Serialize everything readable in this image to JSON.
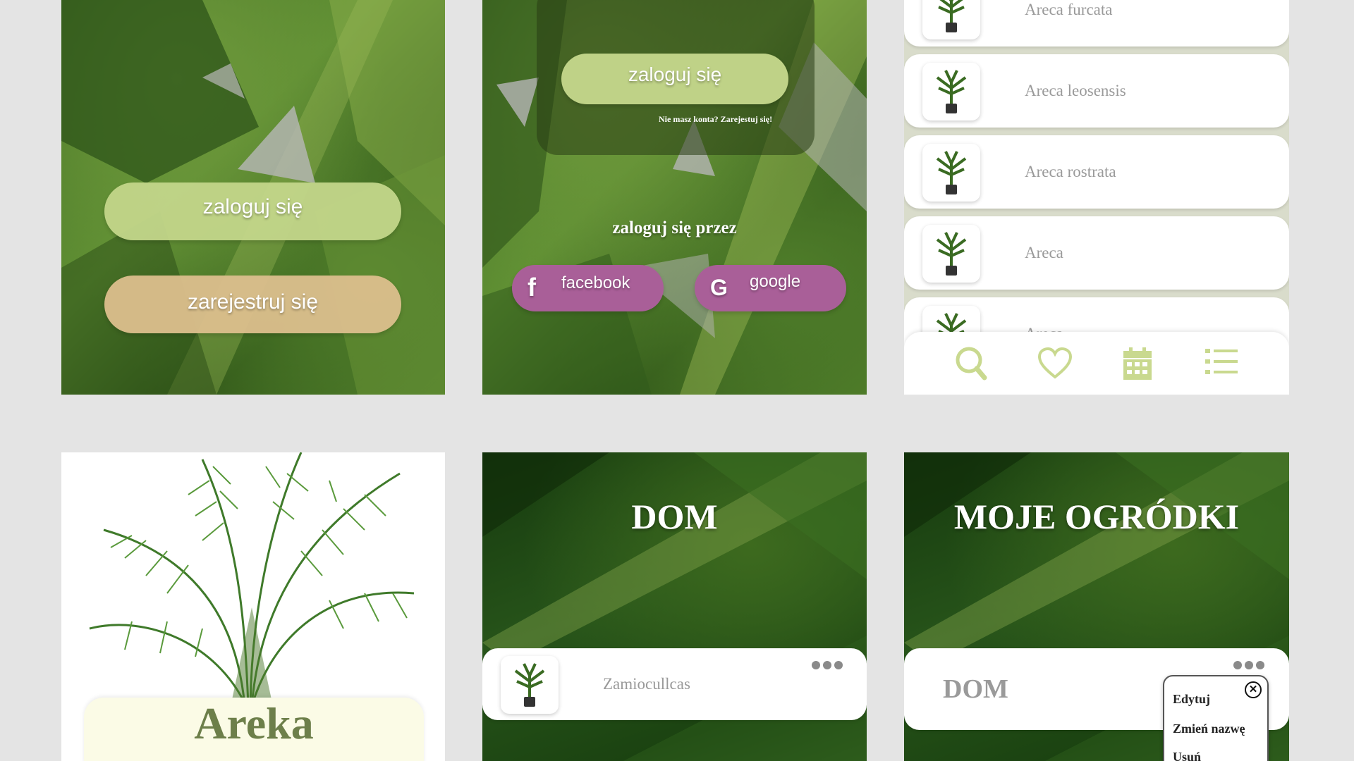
{
  "login_screen": {
    "login_button": "zaloguj się",
    "register_button": "zarejestruj się"
  },
  "social_login_screen": {
    "login_button": "zaloguj się",
    "register_prompt": "Nie masz konta? Zarejestuj się!",
    "login_via_label": "zaloguj się przez",
    "facebook_button": "facebook",
    "google_button": "google"
  },
  "plant_list_screen": {
    "items": [
      {
        "label": "Areca furcata"
      },
      {
        "label": "Areca leosensis"
      },
      {
        "label": "Areca rostrata"
      },
      {
        "label": "Areca"
      },
      {
        "label": "Areca"
      }
    ],
    "nav": [
      {
        "icon": "search-icon"
      },
      {
        "icon": "heart-icon"
      },
      {
        "icon": "calendar-icon"
      },
      {
        "icon": "list-icon"
      }
    ]
  },
  "plant_detail_screen": {
    "plant_name": "Areka"
  },
  "garden_screen": {
    "title": "DOM",
    "plant_item": "Zamiocullcas"
  },
  "gardens_screen": {
    "title": "MOJE OGRÓDKI",
    "garden_item": "DOM",
    "context_menu": [
      "Edytuj",
      "Zmień nazwę",
      "Usuń"
    ]
  },
  "colors": {
    "accent_green": "#c3d68a",
    "accent_peach": "#dcbf8d",
    "accent_purple": "#a95f98",
    "icon_green": "#c9d98f",
    "background": "#e4e4e4"
  }
}
